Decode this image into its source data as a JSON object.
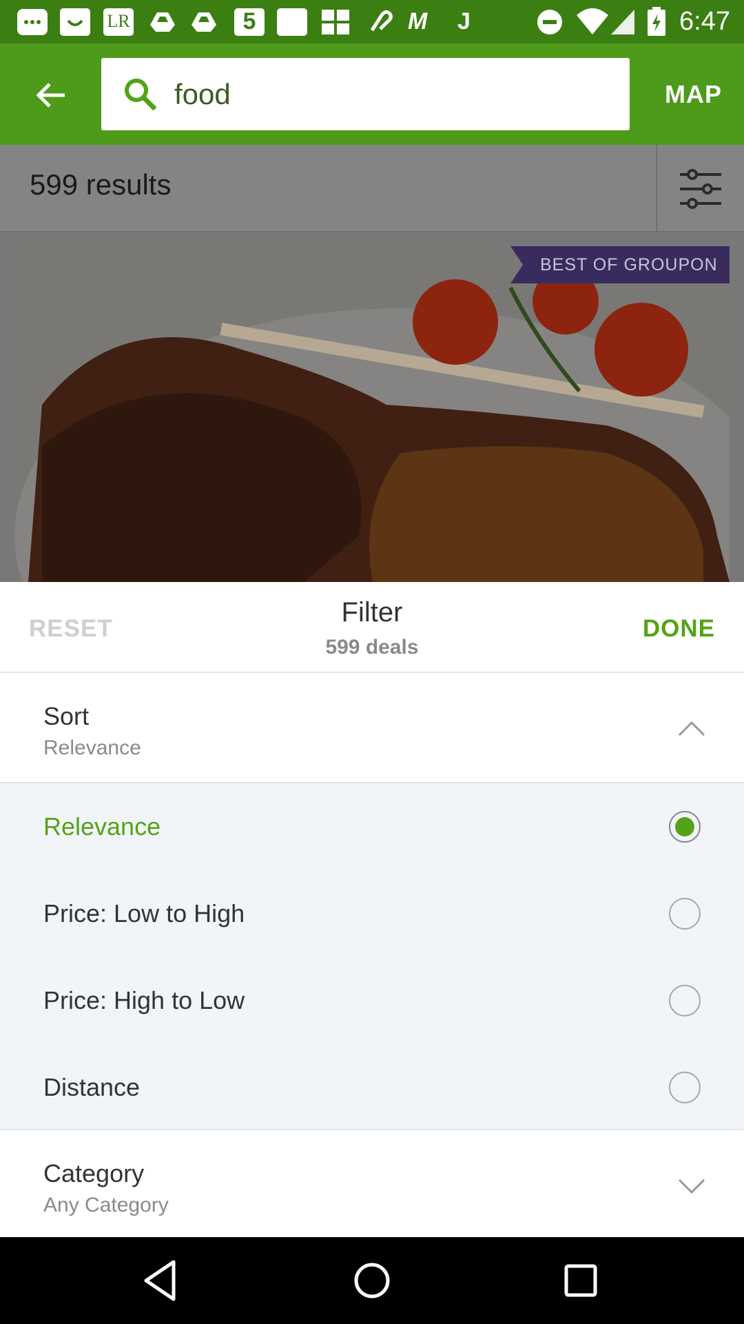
{
  "status_bar": {
    "time": "6:47",
    "left_icons": [
      "chat-icon",
      "smile-app-icon",
      "lr-app-icon",
      "drive-icon",
      "drive-icon",
      "five-app-icon",
      "blank-app-icon",
      "grid-app-icon",
      "link-app-icon",
      "m-app-icon",
      "j-app-icon"
    ],
    "right_icons": [
      "do-not-disturb-icon",
      "wifi-icon",
      "signal-icon",
      "battery-charging-icon"
    ],
    "lr_text": "LR",
    "five_text": "5",
    "m_text": "M",
    "j_text": "J"
  },
  "toolbar": {
    "search_value": "food",
    "map_label": "MAP",
    "color": "#4e9a1a"
  },
  "results": {
    "count_label": "599 results"
  },
  "deal": {
    "badge_label": "BEST OF GROUPON"
  },
  "filter": {
    "reset_label": "RESET",
    "title": "Filter",
    "subtitle": "599 deals",
    "done_label": "DONE",
    "accent_color": "#53a318",
    "sort": {
      "title": "Sort",
      "value": "Relevance",
      "options": [
        {
          "label": "Relevance",
          "selected": true
        },
        {
          "label": "Price: Low to High",
          "selected": false
        },
        {
          "label": "Price: High to Low",
          "selected": false
        },
        {
          "label": "Distance",
          "selected": false
        }
      ]
    },
    "category": {
      "title": "Category",
      "value": "Any Category"
    }
  },
  "nav": {
    "icons": [
      "back-triangle-icon",
      "home-circle-icon",
      "recents-square-icon"
    ]
  }
}
